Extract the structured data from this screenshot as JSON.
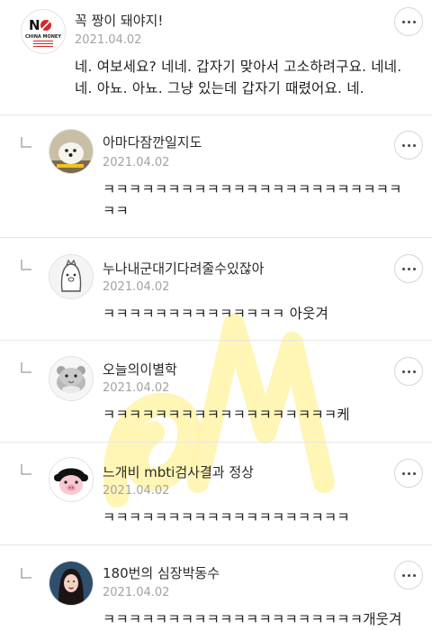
{
  "comments": [
    {
      "author": "꼭 짱이 돼야지!",
      "date": "2021.04.02",
      "text": "네. 여보세요? 네네. 갑자기 맞아서 고소하려구요. 네네. 네. 아뇨. 아뇨. 그냥 있는데 갑자기 때렸어요. 네.",
      "avatar_icon": "no-china-money-logo-icon",
      "avatar_logo_text": "CHINA MONEY",
      "is_reply": false
    },
    {
      "author": "아마다잠깐일지도",
      "date": "2021.04.02",
      "text": "ㅋㅋㅋㅋㅋㅋㅋㅋㅋㅋㅋㅋㅋㅋㅋㅋㅋㅋㅋㅋㅋㅋㅋㅋㅋ",
      "avatar_icon": "white-dog-photo-icon",
      "is_reply": true
    },
    {
      "author": "누나내군대기다려줄수있잖아",
      "date": "2021.04.02",
      "text": "ㅋㅋㅋㅋㅋㅋㅋㅋㅋㅋㅋㅋㅋㅋ 아웃겨",
      "avatar_icon": "cartoon-character-icon",
      "is_reply": true
    },
    {
      "author": "오늘의이별학",
      "date": "2021.04.02",
      "text": "ㅋㅋㅋㅋㅋㅋㅋㅋㅋㅋㅋㅋㅋㅋㅋㅋㅋㅋ케",
      "avatar_icon": "hamster-icon",
      "is_reply": true
    },
    {
      "author": "느개비 mbti검사결과 정상",
      "date": "2021.04.02",
      "text": "ㅋㅋㅋㅋㅋㅋㅋㅋㅋㅋㅋㅋㅋㅋㅋㅋㅋㅋㅋ",
      "avatar_icon": "pig-girl-icon",
      "is_reply": true
    },
    {
      "author": "180번의 심장박동수",
      "date": "2021.04.02",
      "text": "ㅋㅋㅋㅋㅋㅋㅋㅋㅋㅋㅋㅋㅋㅋㅋㅋㅋㅋㅋㅋ개웃겨",
      "avatar_icon": "woman-portrait-icon",
      "is_reply": true
    }
  ],
  "more_button_icon": "more-horizontal-icon",
  "reply_indicator_icon": "reply-corner-icon",
  "colors": {
    "date": "#a3a3a3",
    "divider": "#e6e6e6",
    "watermark": "#fff3a8"
  }
}
